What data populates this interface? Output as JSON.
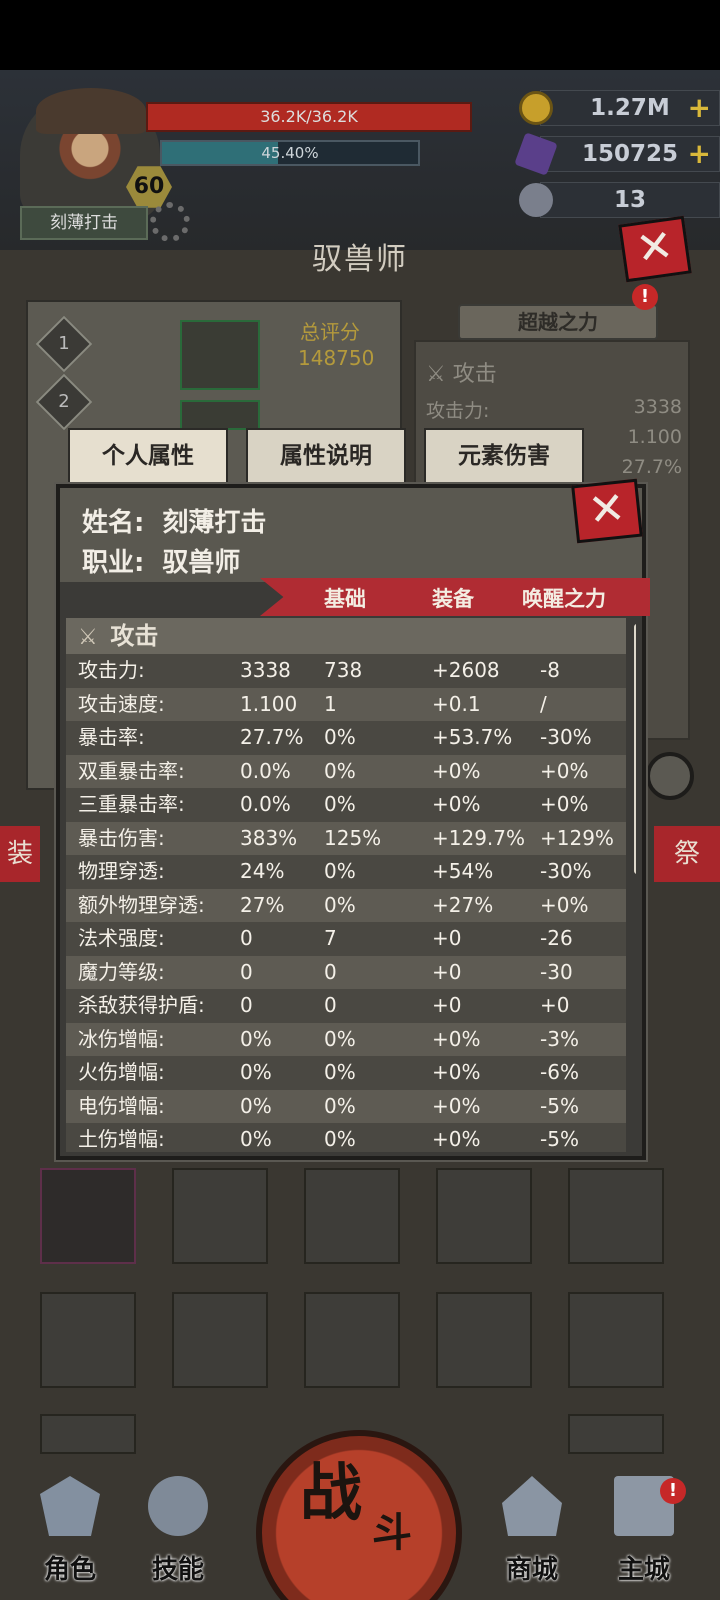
{
  "hero": {
    "hp": "36.2K/36.2K",
    "hp_fraction": 1.0,
    "xp_text": "45.40%",
    "xp_fraction": 0.454,
    "level": "60",
    "name_plate": "刻薄打击"
  },
  "resources": {
    "gold": "1.27M",
    "gem": "150725",
    "token": "13"
  },
  "panel": {
    "title": "驭兽师",
    "surpass_label": "超越之力",
    "score_label": "总评分",
    "score_value": "148750",
    "slot1": "1",
    "slot2": "2",
    "alert": "!"
  },
  "bg_stats": {
    "section": "攻击",
    "rows": [
      {
        "label": "攻击力:",
        "value": "3338"
      },
      {
        "label": "",
        "value": "1.100"
      },
      {
        "label": "",
        "value": "27.7%"
      }
    ]
  },
  "tabs": {
    "personal": "个人属性",
    "explain": "属性说明",
    "element": "元素伤害"
  },
  "dialog": {
    "name_label": "姓名:",
    "name_value": "刻薄打击",
    "job_label": "职业:",
    "job_value": "驭兽师",
    "col_base": "基础",
    "col_equip": "装备",
    "col_awaken": "唤醒之力",
    "section": "攻击",
    "rows": [
      {
        "name": "攻击力:",
        "total": "3338",
        "base": "738",
        "equip": "+2608",
        "awaken": "-8"
      },
      {
        "name": "攻击速度:",
        "total": "1.100",
        "base": "1",
        "equip": "+0.1",
        "awaken": "/"
      },
      {
        "name": "暴击率:",
        "total": "27.7%",
        "base": "0%",
        "equip": "+53.7%",
        "awaken": "-30%"
      },
      {
        "name": "双重暴击率:",
        "total": "0.0%",
        "base": "0%",
        "equip": "+0%",
        "awaken": "+0%"
      },
      {
        "name": "三重暴击率:",
        "total": "0.0%",
        "base": "0%",
        "equip": "+0%",
        "awaken": "+0%"
      },
      {
        "name": "暴击伤害:",
        "total": "383%",
        "base": "125%",
        "equip": "+129.7%",
        "awaken": "+129%"
      },
      {
        "name": "物理穿透:",
        "total": "24%",
        "base": "0%",
        "equip": "+54%",
        "awaken": "-30%"
      },
      {
        "name": "额外物理穿透:",
        "total": "27%",
        "base": "0%",
        "equip": "+27%",
        "awaken": "+0%"
      },
      {
        "name": "法术强度:",
        "total": "0",
        "base": "7",
        "equip": "+0",
        "awaken": "-26"
      },
      {
        "name": "魔力等级:",
        "total": "0",
        "base": "0",
        "equip": "+0",
        "awaken": "-30"
      },
      {
        "name": "杀敌获得护盾:",
        "total": "0",
        "base": "0",
        "equip": "+0",
        "awaken": "+0"
      },
      {
        "name": "冰伤增幅:",
        "total": "0%",
        "base": "0%",
        "equip": "+0%",
        "awaken": "-3%"
      },
      {
        "name": "火伤增幅:",
        "total": "0%",
        "base": "0%",
        "equip": "+0%",
        "awaken": "-6%"
      },
      {
        "name": "电伤增幅:",
        "total": "0%",
        "base": "0%",
        "equip": "+0%",
        "awaken": "-5%"
      },
      {
        "name": "土伤增幅:",
        "total": "0%",
        "base": "0%",
        "equip": "+0%",
        "awaken": "-5%"
      }
    ]
  },
  "side": {
    "left_tag": "装",
    "right_tag": "祭"
  },
  "nav": {
    "role": "角色",
    "skill": "技能",
    "battle_main": "战",
    "battle_sub": "斗",
    "shop": "商城",
    "city": "主城",
    "alert": "!"
  },
  "colors": {
    "accent_red": "#b02c33",
    "gold": "#b49a3c",
    "hp_red": "#b02a22",
    "xp_teal": "#2f6f77"
  }
}
